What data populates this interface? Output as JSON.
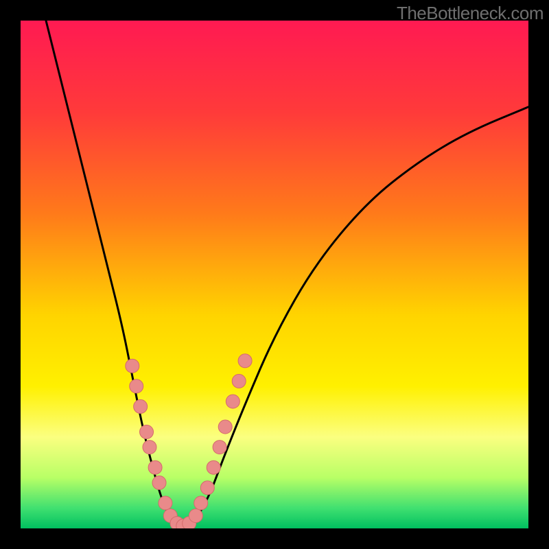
{
  "attribution": "TheBottleneck.com",
  "chart_data": {
    "type": "line",
    "title": "",
    "xlabel": "",
    "ylabel": "",
    "xlim": [
      0,
      100
    ],
    "ylim": [
      0,
      100
    ],
    "background_gradient_stops": [
      {
        "pct": 0,
        "color": "#ff1a52"
      },
      {
        "pct": 18,
        "color": "#ff3a3a"
      },
      {
        "pct": 38,
        "color": "#ff7a1a"
      },
      {
        "pct": 58,
        "color": "#ffd400"
      },
      {
        "pct": 72,
        "color": "#fff000"
      },
      {
        "pct": 82,
        "color": "#fbff80"
      },
      {
        "pct": 90,
        "color": "#b8ff66"
      },
      {
        "pct": 96,
        "color": "#40e070"
      },
      {
        "pct": 100,
        "color": "#00c060"
      }
    ],
    "series": [
      {
        "name": "bottleneck-curve",
        "stroke": "#000000",
        "points": [
          {
            "x": 5,
            "y": 100
          },
          {
            "x": 8,
            "y": 88
          },
          {
            "x": 11,
            "y": 76
          },
          {
            "x": 14,
            "y": 64
          },
          {
            "x": 17,
            "y": 52
          },
          {
            "x": 20,
            "y": 40
          },
          {
            "x": 22,
            "y": 30
          },
          {
            "x": 24,
            "y": 20
          },
          {
            "x": 26,
            "y": 12
          },
          {
            "x": 28,
            "y": 5
          },
          {
            "x": 30,
            "y": 1
          },
          {
            "x": 32,
            "y": 0
          },
          {
            "x": 34,
            "y": 1
          },
          {
            "x": 37,
            "y": 6
          },
          {
            "x": 40,
            "y": 14
          },
          {
            "x": 44,
            "y": 24
          },
          {
            "x": 50,
            "y": 38
          },
          {
            "x": 58,
            "y": 52
          },
          {
            "x": 68,
            "y": 64
          },
          {
            "x": 78,
            "y": 72
          },
          {
            "x": 88,
            "y": 78
          },
          {
            "x": 100,
            "y": 83
          }
        ]
      }
    ],
    "markers": {
      "name": "highlight-dots",
      "fill": "#e98a8a",
      "stroke": "#d46b6b",
      "radius": 10,
      "points": [
        {
          "x": 22.0,
          "y": 32
        },
        {
          "x": 22.8,
          "y": 28
        },
        {
          "x": 23.6,
          "y": 24
        },
        {
          "x": 24.8,
          "y": 19
        },
        {
          "x": 25.4,
          "y": 16
        },
        {
          "x": 26.5,
          "y": 12
        },
        {
          "x": 27.3,
          "y": 9
        },
        {
          "x": 28.5,
          "y": 5
        },
        {
          "x": 29.5,
          "y": 2.5
        },
        {
          "x": 30.8,
          "y": 1
        },
        {
          "x": 32.0,
          "y": 0.5
        },
        {
          "x": 33.2,
          "y": 1
        },
        {
          "x": 34.5,
          "y": 2.5
        },
        {
          "x": 35.5,
          "y": 5
        },
        {
          "x": 36.8,
          "y": 8
        },
        {
          "x": 38.0,
          "y": 12
        },
        {
          "x": 39.2,
          "y": 16
        },
        {
          "x": 40.3,
          "y": 20
        },
        {
          "x": 41.8,
          "y": 25
        },
        {
          "x": 43.0,
          "y": 29
        },
        {
          "x": 44.2,
          "y": 33
        }
      ]
    }
  }
}
